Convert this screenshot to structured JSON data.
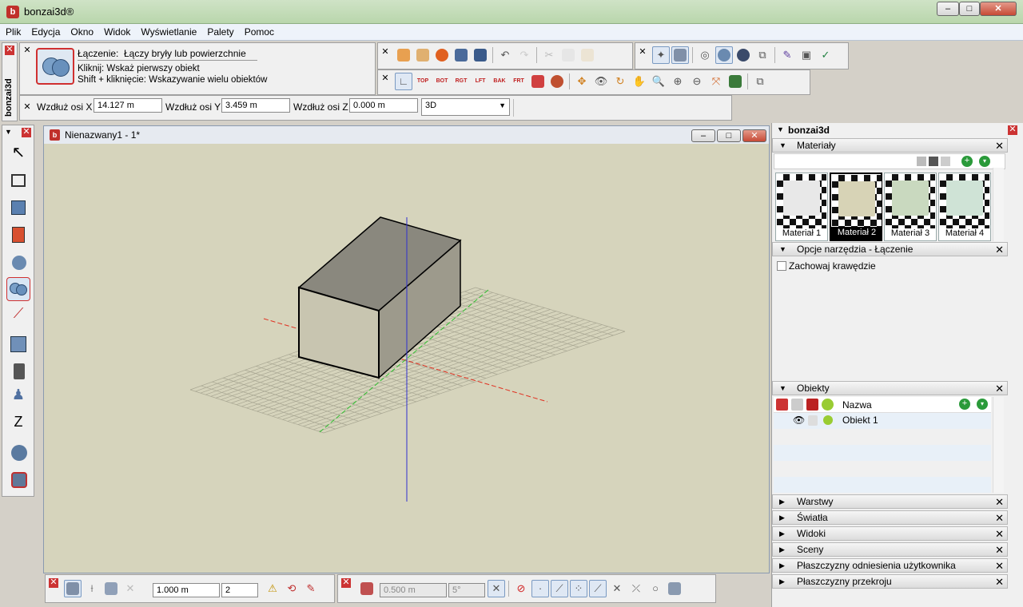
{
  "window": {
    "title": "bonzai3d®",
    "logo": "b"
  },
  "menu": [
    "Plik",
    "Edycja",
    "Okno",
    "Widok",
    "Wyświetlanie",
    "Palety",
    "Pomoc"
  ],
  "tool_info": {
    "name_label": "Łączenie:",
    "description": "Łączy bryły lub powierzchnie",
    "line1": "Kliknij: Wskaż pierwszy obiekt",
    "line2": "Shift + kliknięcie: Wskazywanie wielu obiektów"
  },
  "side_tab": "bonzai3d",
  "coords": {
    "x_label": "Wzdłuż osi X",
    "x_value": "14.127 m",
    "y_label": "Wzdłuż osi Y",
    "y_value": "3.459 m",
    "z_label": "Wzdłuż osi Z",
    "z_value": "0.000 m",
    "view_mode": "3D"
  },
  "toolbar_top_labels": [
    "TOP",
    "BOT",
    "RGT",
    "LFT",
    "BAK",
    "FRT"
  ],
  "document": {
    "title": "Nienazwany1 - 1*"
  },
  "right_panel": {
    "title": "bonzai3d",
    "materials_header": "Materiały",
    "materials": [
      "Materiał 1",
      "Materiał 2",
      "Materiał 3",
      "Materiał 4"
    ],
    "selected_material": "Materiał 2",
    "tool_options_header": "Opcje narzędzia - Łączenie",
    "keep_edges_label": "Zachowaj krawędzie",
    "objects_header": "Obiekty",
    "objects_col_name": "Nazwa",
    "objects": [
      "Obiekt 1"
    ],
    "collapsed_sections": [
      "Warstwy",
      "Światła",
      "Widoki",
      "Sceny",
      "Płaszczyzny odniesienia użytkownika",
      "Płaszczyzny przekroju"
    ]
  },
  "bottom": {
    "grid_spacing": "1.000 m",
    "grid_divisions": "2",
    "snap_distance": "0.500 m",
    "snap_angle": "5°"
  },
  "colors": {
    "accent_red": "#cc2a2a",
    "x_axis": "#e03020",
    "y_axis": "#30c030",
    "z_axis": "#3030d0",
    "viewport": "#d6d4bc"
  }
}
